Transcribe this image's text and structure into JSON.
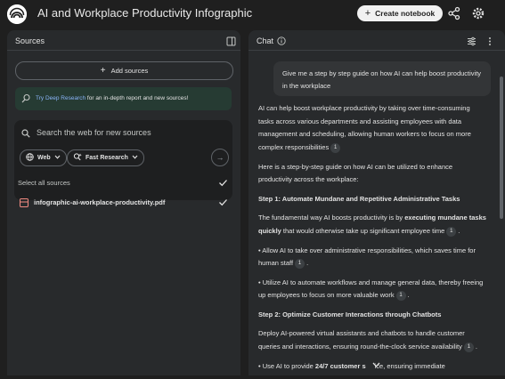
{
  "app": {
    "title": "AI and Workplace Productivity Infographic",
    "create_label": "Create notebook"
  },
  "sources": {
    "title": "Sources",
    "add_label": "Add sources",
    "deep_research": {
      "link": "Try Deep Research",
      "rest": " for an in-depth report and new sources!"
    },
    "search_placeholder": "Search the web for new sources",
    "web_label": "Web",
    "research_label": "Fast Research",
    "select_all": "Select all sources",
    "files": [
      "infographic-ai-workplace-productivity.pdf"
    ]
  },
  "chat": {
    "title": "Chat",
    "user_message": "Give me a step by step guide on how AI can help boost productivity in the workplace",
    "answer": {
      "p1": "AI can help boost workplace productivity by taking over time-consuming tasks across various departments and assisting employees with data management and scheduling, allowing human workers to focus on more complex responsibilities",
      "p2": "Here is a step-by-step guide on how AI can be utilized to enhance productivity across the workplace:",
      "step1": "Step 1: Automate Mundane and Repetitive Administrative Tasks",
      "p3a": "The fundamental way AI boosts productivity is by ",
      "p3b": "executing mundane tasks quickly",
      "p3c": " that would otherwise take up significant employee time",
      "b1": "• Allow AI to take over administrative responsibilities, which saves time for human staff",
      "b2": "• Utilize AI to automate workflows and manage general data, thereby freeing up employees to focus on more valuable work",
      "step2": "Step 2: Optimize Customer Interactions through Chatbots",
      "p4": "Deploy AI-powered virtual assistants and chatbots to handle customer queries and interactions, ensuring round-the-clock service availability",
      "b3a": "• Use AI to provide ",
      "b3b": "24/7 customer s",
      "b3c": "ice",
      "b3d": ", ensuring immediate",
      "cite": "1"
    }
  }
}
